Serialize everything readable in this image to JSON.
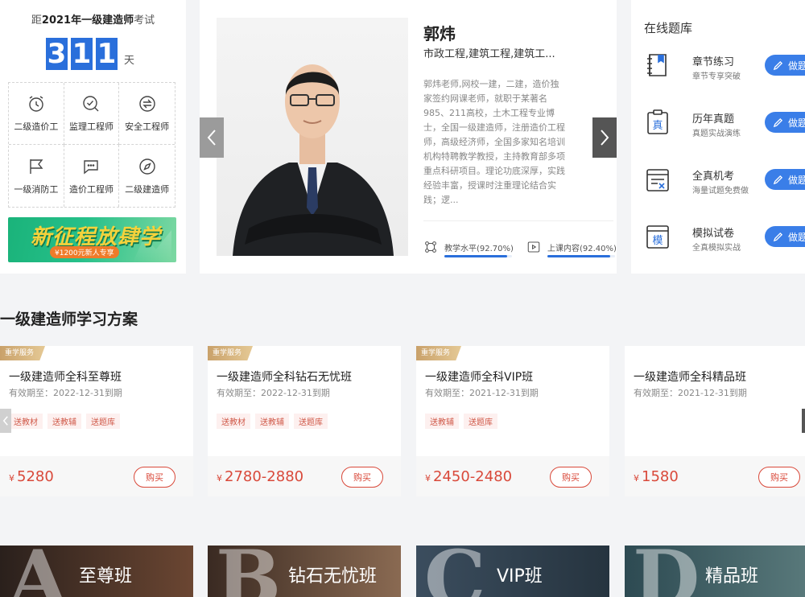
{
  "countdown": {
    "prefix": "距",
    "year_exam": "2021年一级建造师",
    "suffix": "考试",
    "digits": [
      "3",
      "1",
      "1"
    ],
    "unit": "天"
  },
  "subjects": [
    {
      "label": "二级造价工",
      "icon": "alarm-clock-icon"
    },
    {
      "label": "监理工程师",
      "icon": "magnifier-check-icon"
    },
    {
      "label": "安全工程师",
      "icon": "arrow-circle-icon"
    },
    {
      "label": "一级消防工",
      "icon": "flag-icon"
    },
    {
      "label": "造价工程师",
      "icon": "chat-bubble-icon"
    },
    {
      "label": "二级建造师",
      "icon": "compass-icon"
    }
  ],
  "promo": {
    "title": "新征程放肆学",
    "sub": "¥1200元新人专享"
  },
  "teacher": {
    "name": "郭炜",
    "subjects": "市政工程,建筑工程,建筑工...",
    "bio": "郭炜老师,网校一建，二建，造价独家签约网课老师，就职于某著名985、211高校，土木工程专业博士，全国一级建造师，注册造价工程师，高级经济师，全国多家知名培训机构特聘教学教授，主持教育部多项重点科研项目。理论功底深厚，实践经验丰富，授课时注重理论结合实践；逻...",
    "metrics": [
      {
        "label": "教学水平(92.70%)",
        "value": 92.7,
        "icon": "network-icon"
      },
      {
        "label": "上课内容(92.40%)",
        "value": 92.4,
        "icon": "play-icon"
      }
    ]
  },
  "bank": {
    "title": "在线题库",
    "button_label": "做题",
    "items": [
      {
        "name": "章节练习",
        "desc": "章节专享突破",
        "icon": "book-icon"
      },
      {
        "name": "历年真题",
        "desc": "真题实战演练",
        "icon": "clipboard-icon",
        "glyph": "真"
      },
      {
        "name": "全真机考",
        "desc": "海量试题免费做",
        "icon": "exam-icon"
      },
      {
        "name": "模拟试卷",
        "desc": "全真模拟实战",
        "icon": "window-icon",
        "glyph": "模"
      }
    ]
  },
  "section_title": "一级建造师学习方案",
  "courses": [
    {
      "tag": "重学服务",
      "name": "一级建造师全科至尊班",
      "valid": "有效期至：2022-12-31到期",
      "perks": [
        "送教材",
        "送教辅",
        "送题库"
      ],
      "currency": "¥",
      "price": "5280",
      "buy": "购买"
    },
    {
      "tag": "重学服务",
      "name": "一级建造师全科钻石无忧班",
      "valid": "有效期至：2022-12-31到期",
      "perks": [
        "送教材",
        "送教辅",
        "送题库"
      ],
      "currency": "¥",
      "price": "2780-2880",
      "buy": "购买"
    },
    {
      "tag": "重学服务",
      "name": "一级建造师全科VIP班",
      "valid": "有效期至：2021-12-31到期",
      "perks": [
        "送教辅",
        "送题库"
      ],
      "currency": "¥",
      "price": "2450-2480",
      "buy": "购买"
    },
    {
      "tag": "",
      "name": "一级建造师全科精品班",
      "valid": "有效期至：2021-12-31到期",
      "perks": [],
      "currency": "¥",
      "price": "1580",
      "buy": "购买"
    }
  ],
  "tiers": [
    {
      "letter": "A",
      "label": "至尊班",
      "color1": "#2a201c",
      "color2": "#6b4632"
    },
    {
      "letter": "B",
      "label": "钻石无忧班",
      "color1": "#3a2a22",
      "color2": "#8a6a52"
    },
    {
      "letter": "C",
      "label": "VIP班",
      "color1": "#3b4d5e",
      "color2": "#26343f"
    },
    {
      "letter": "D",
      "label": "精品班",
      "color1": "#2d4a52",
      "color2": "#58787a"
    }
  ],
  "colors": {
    "accent": "#2a6fdb",
    "price": "#d9493a",
    "button": "#3a7ee8"
  }
}
